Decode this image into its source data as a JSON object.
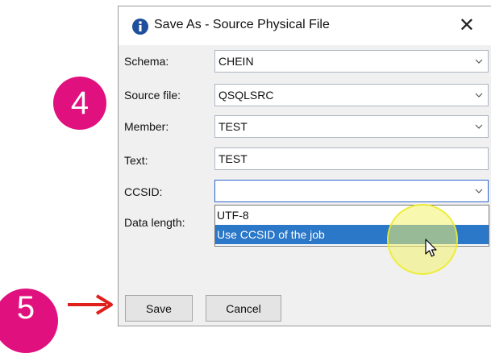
{
  "callouts": {
    "step4": "4",
    "step5": "5"
  },
  "dialog": {
    "title": "Save As - Source Physical File",
    "close_glyph": "✕",
    "fields": {
      "schema": {
        "label": "Schema:",
        "value": "CHEIN"
      },
      "source_file": {
        "label": "Source file:",
        "value": "QSQLSRC"
      },
      "member": {
        "label": "Member:",
        "value": "TEST"
      },
      "text": {
        "label": "Text:",
        "value": "TEST"
      },
      "ccsid": {
        "label": "CCSID:",
        "value": ""
      },
      "data_length": {
        "label": "Data length:"
      }
    },
    "ccsid_options": [
      "UTF-8",
      "Use CCSID of the job"
    ],
    "buttons": {
      "save": "Save",
      "cancel": "Cancel"
    }
  },
  "colors": {
    "callout": "#e0117f",
    "selection": "#2b77c8",
    "arrow": "#e0201c",
    "highlight": "#f2f26e"
  },
  "icons": {
    "title": "info-icon",
    "close": "close-icon",
    "dropdown": "chevron-down-icon",
    "cursor": "mouse-pointer-icon"
  }
}
